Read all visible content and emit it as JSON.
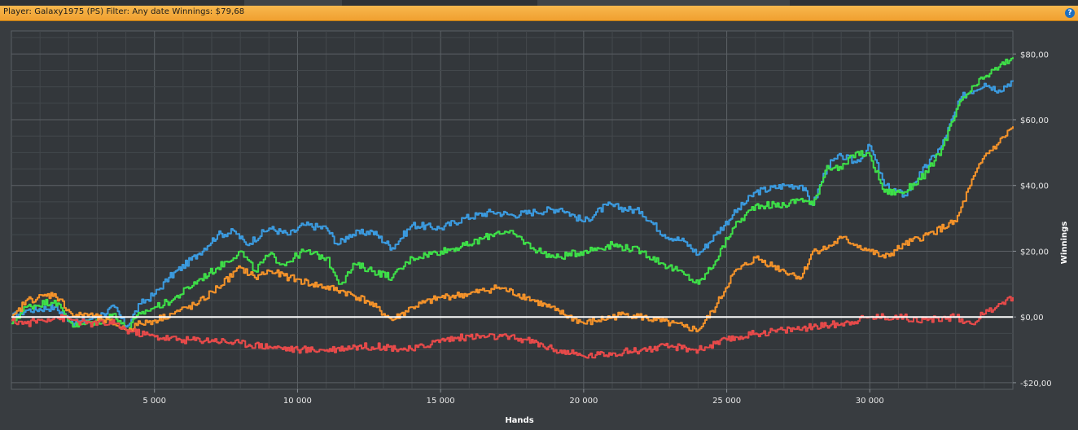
{
  "header": {
    "text": "Player: Galaxy1975 (PS) Filter: Any date Winnings: $79,68",
    "help_glyph": "?"
  },
  "chart_data": {
    "type": "line",
    "xlabel": "Hands",
    "ylabel": "Winnings",
    "xlim": [
      0,
      35000
    ],
    "ylim": [
      -22,
      87
    ],
    "x_ticks": [
      5000,
      10000,
      15000,
      20000,
      25000,
      30000
    ],
    "x_tick_labels": [
      "5 000",
      "10 000",
      "15 000",
      "20 000",
      "25 000",
      "30 000"
    ],
    "y_ticks": [
      80,
      60,
      40,
      20,
      0,
      -20
    ],
    "y_tick_labels": [
      "$80,00",
      "$60,00",
      "$40,00",
      "$20,00",
      "$0,00",
      "-$20,00"
    ],
    "grid": true,
    "zero_line_color": "#ffffff",
    "series": [
      {
        "color": "#3b9be0",
        "x": [
          0,
          500,
          1500,
          2200,
          2600,
          3200,
          3600,
          4000,
          4500,
          5000,
          5500,
          6500,
          7200,
          7800,
          8200,
          9000,
          9700,
          10200,
          11000,
          11400,
          11800,
          12600,
          13300,
          14000,
          15000,
          15800,
          16800,
          17500,
          18300,
          19200,
          20000,
          20800,
          22000,
          22800,
          23500,
          24000,
          24600,
          25200,
          26000,
          27000,
          27600,
          28000,
          28500,
          29000,
          29500,
          30000,
          30500,
          31200,
          31800,
          32500,
          33200,
          34000,
          34500,
          35000
        ],
        "y": [
          0,
          2,
          3,
          -2,
          -1,
          1,
          3,
          -3,
          4,
          7,
          12,
          19,
          25,
          26,
          22,
          27,
          25,
          28,
          27,
          22,
          25,
          26,
          21,
          28,
          27,
          30,
          32,
          31,
          32,
          33,
          29,
          34,
          32,
          25,
          23,
          19,
          25,
          31,
          38,
          40,
          40,
          34,
          46,
          49,
          47,
          52,
          40,
          37,
          44,
          52,
          67,
          71,
          69,
          72
        ]
      },
      {
        "color": "#3ee048",
        "x": [
          0,
          500,
          1500,
          2200,
          2600,
          3200,
          3600,
          4000,
          4500,
          5000,
          5600,
          6500,
          7200,
          8000,
          8500,
          9000,
          9500,
          10200,
          11000,
          11500,
          12000,
          13300,
          14000,
          15000,
          16000,
          17000,
          17600,
          18200,
          19000,
          20000,
          21000,
          22000,
          22800,
          23500,
          24000,
          24600,
          25200,
          26000,
          27000,
          27600,
          28000,
          28500,
          29000,
          29500,
          30000,
          30500,
          31200,
          32000,
          32500,
          33200,
          34000,
          34500,
          35000
        ],
        "y": [
          -2,
          3,
          5,
          -3,
          -2,
          -1,
          1,
          -4,
          1,
          3,
          5,
          11,
          15,
          20,
          14,
          19,
          16,
          20,
          18,
          10,
          16,
          12,
          18,
          20,
          22,
          26,
          25,
          21,
          18,
          20,
          22,
          20,
          16,
          13,
          10,
          17,
          27,
          34,
          34,
          36,
          34,
          46,
          45,
          50,
          49,
          38,
          38,
          44,
          51,
          66,
          73,
          76,
          79
        ]
      },
      {
        "color": "#f5932a",
        "x": [
          0,
          500,
          1500,
          2200,
          2600,
          3200,
          3600,
          4000,
          4500,
          5000,
          5600,
          6500,
          7200,
          8000,
          8500,
          9000,
          9700,
          10500,
          11500,
          12400,
          13300,
          14000,
          15000,
          16000,
          17000,
          18000,
          19000,
          20000,
          20500,
          21500,
          22500,
          23500,
          24000,
          24600,
          25200,
          26000,
          27000,
          27600,
          28000,
          28500,
          29000,
          29500,
          30000,
          30500,
          31200,
          32000,
          33000,
          33500,
          34000,
          34500,
          35000
        ],
        "y": [
          -1,
          5,
          7,
          0,
          1,
          -1,
          -2,
          -4,
          -2,
          -1,
          1,
          4,
          9,
          15,
          12,
          14,
          12,
          10,
          8,
          5,
          -1,
          3,
          6,
          7,
          9,
          6,
          2,
          -2,
          -1,
          1,
          -1,
          -3,
          -4,
          3,
          13,
          18,
          14,
          12,
          20,
          21,
          24,
          22,
          20,
          18,
          22,
          25,
          29,
          40,
          49,
          53,
          58
        ]
      },
      {
        "color": "#e84a4a",
        "x": [
          0,
          500,
          1500,
          2200,
          2600,
          3200,
          3600,
          4000,
          5000,
          6000,
          7000,
          8000,
          9000,
          10000,
          11000,
          12000,
          13000,
          14000,
          15000,
          16000,
          17000,
          18000,
          19000,
          20000,
          21000,
          22000,
          23000,
          24000,
          25000,
          26000,
          27000,
          28000,
          29000,
          30000,
          31000,
          32000,
          33000,
          33500,
          34000,
          34500,
          35000
        ],
        "y": [
          -1,
          -2,
          0,
          -1,
          -2,
          -2,
          -2,
          -4,
          -6,
          -7,
          -7,
          -8,
          -9,
          -10,
          -10,
          -9,
          -9,
          -10,
          -7,
          -6,
          -6,
          -7,
          -10,
          -12,
          -11,
          -10,
          -9,
          -10,
          -7,
          -5,
          -4,
          -3,
          -2,
          0,
          0,
          -1,
          0,
          -2,
          1,
          4,
          6
        ]
      }
    ]
  }
}
